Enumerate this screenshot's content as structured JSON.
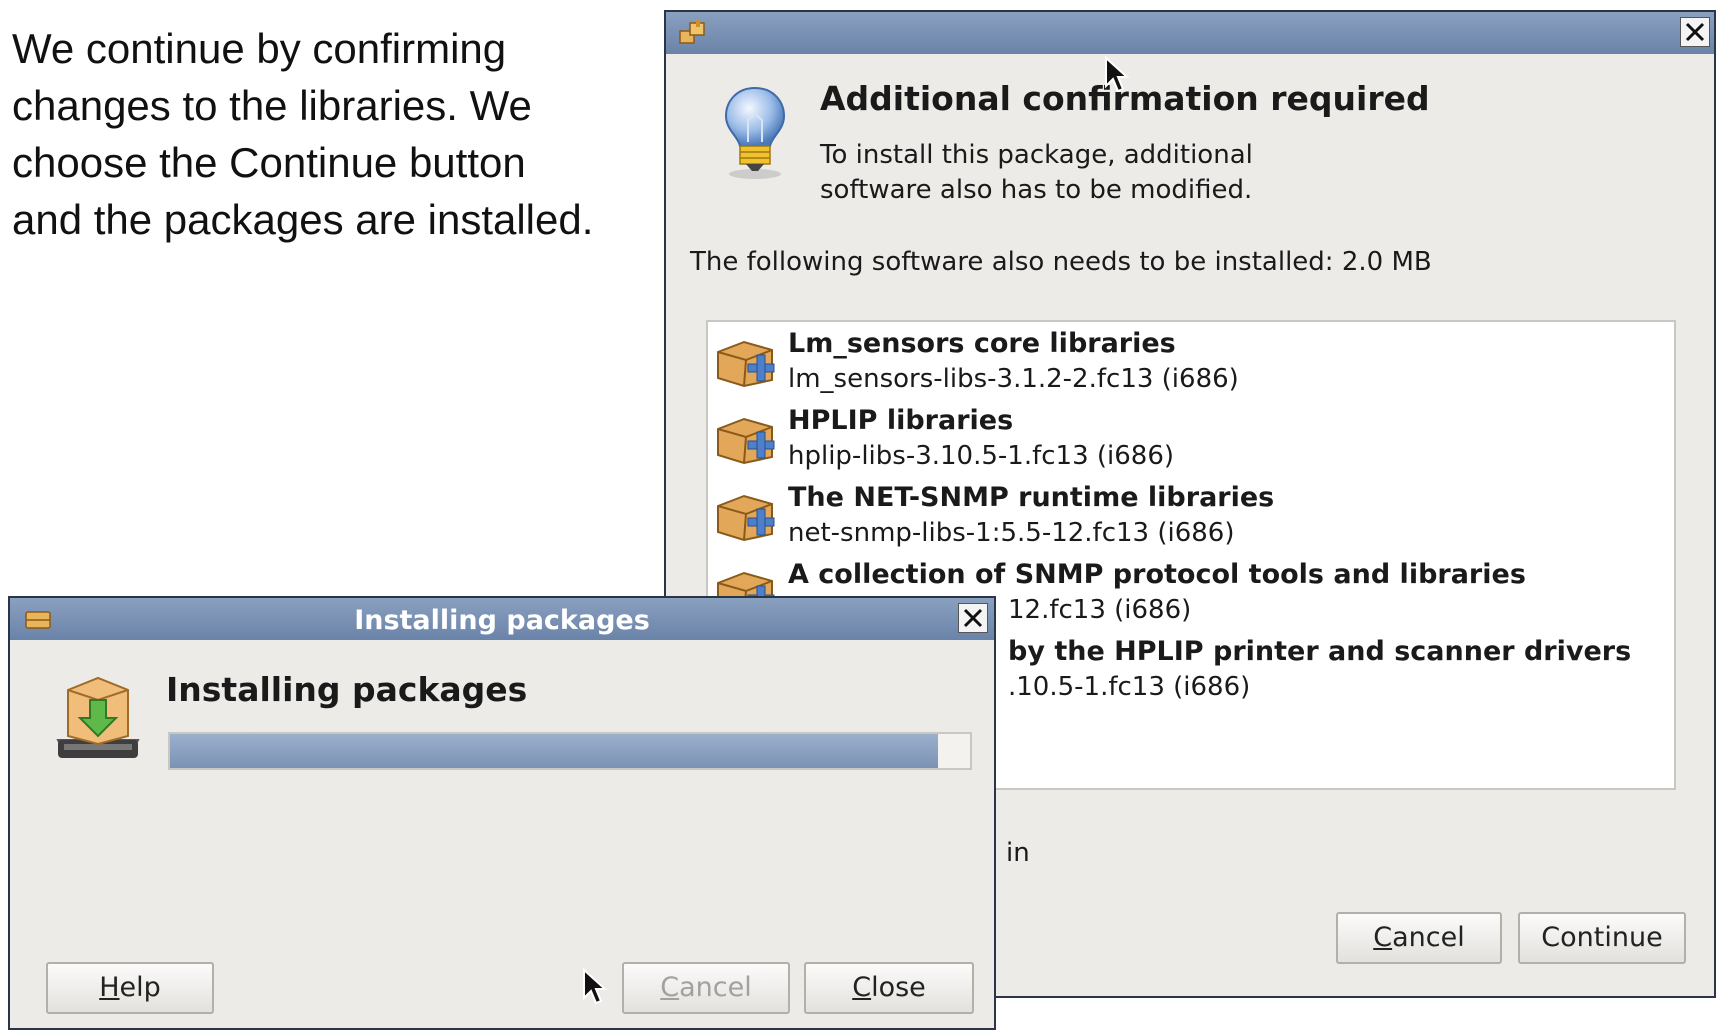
{
  "caption": {
    "lines": [
      "We continue by confirming",
      "changes to the libraries. We",
      "choose the Continue button",
      "and the packages are installed."
    ]
  },
  "confirm_dialog": {
    "heading": "Additional confirmation required",
    "subtext": "To install this package, additional\nsoftware also has to be modified.",
    "need_text": "The following software also needs to be installed: 2.0 MB",
    "packages": [
      {
        "name": "Lm_sensors core libraries",
        "version": "lm_sensors-libs-3.1.2-2.fc13 (i686)"
      },
      {
        "name": "HPLIP libraries",
        "version": "hplip-libs-3.10.5-1.fc13 (i686)"
      },
      {
        "name": "The NET-SNMP runtime libraries",
        "version": "net-snmp-libs-1:5.5-12.fc13 (i686)"
      },
      {
        "name": "A collection of SNMP protocol tools and libraries",
        "version": "12.fc13 (i686)"
      },
      {
        "name": "by the HPLIP printer and scanner drivers",
        "version": ".10.5-1.fc13 (i686)"
      }
    ],
    "partial_text": "in",
    "cancel": {
      "mnemonic": "C",
      "rest": "ancel"
    },
    "continue": "Continue"
  },
  "install_dialog": {
    "title": "Installing packages",
    "heading": "Installing packages",
    "progress_fraction": 0.96,
    "help": {
      "mnemonic": "H",
      "rest": "elp"
    },
    "cancel": {
      "mnemonic": "C",
      "rest": "ancel"
    },
    "close": {
      "mnemonic": "C",
      "rest": "lose"
    }
  },
  "colors": {
    "titlebar": "#7a91b4",
    "progress_fill": "#8aa0c0"
  }
}
